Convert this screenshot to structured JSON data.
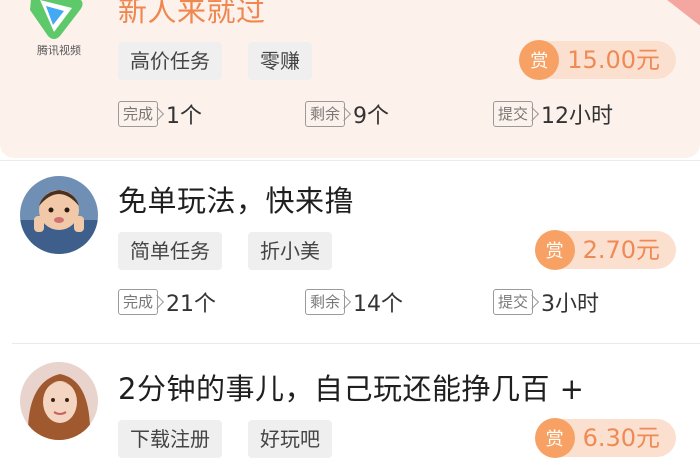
{
  "tasks": [
    {
      "title": "新人来就过",
      "tags": [
        "高价任务",
        "零赚"
      ],
      "reward_icon": "赏",
      "reward": "15.00元",
      "stats": {
        "done_label": "完成",
        "done": "1个",
        "left_label": "剩余",
        "left": "9个",
        "submit_label": "提交",
        "submit": "12小时"
      },
      "avatar_logo_text": "腾讯视频"
    },
    {
      "title": "免单玩法，快来撸",
      "tags": [
        "简单任务",
        "折小美"
      ],
      "reward_icon": "赏",
      "reward": "2.70元",
      "stats": {
        "done_label": "完成",
        "done": "21个",
        "left_label": "剩余",
        "left": "14个",
        "submit_label": "提交",
        "submit": "3小时"
      }
    },
    {
      "title": "2分钟的事儿，自己玩还能挣几百 +",
      "tags": [
        "下载注册",
        "好玩吧"
      ],
      "reward_icon": "赏",
      "reward": "6.30元"
    }
  ],
  "colors": {
    "accent": "#ef8750",
    "highlight_bg": "#fdf1ec",
    "coin": "#f7a264",
    "pill": "#fbe0cf"
  }
}
